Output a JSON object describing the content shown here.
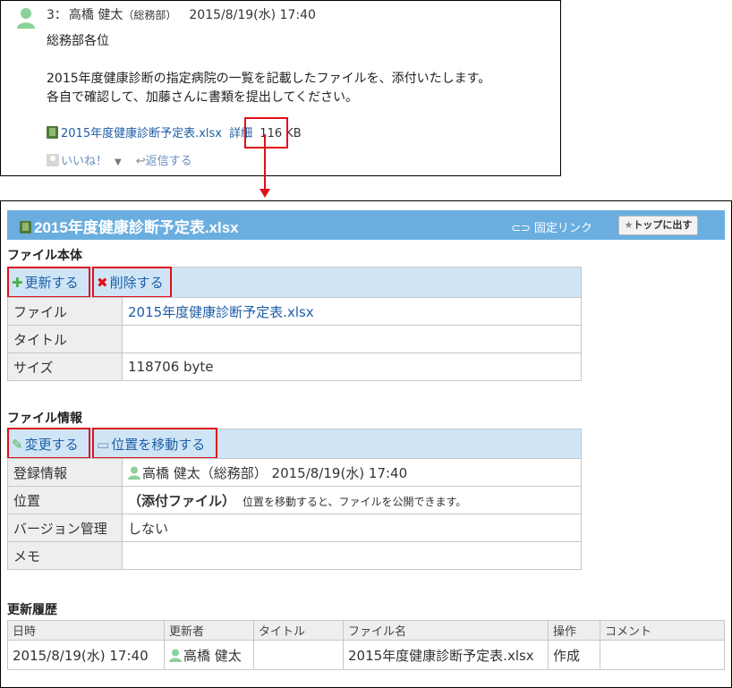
{
  "comment": {
    "number": "3：",
    "author": "高橋 健太",
    "dept": "（総務部）",
    "datetime": "2015/8/19(水) 17:40",
    "lines": [
      "総務部各位",
      "",
      "2015年度健康診断の指定病院の一覧を記載したファイルを、添付いたします。",
      "各自で確認して、加藤さんに書類を提出してください。"
    ],
    "attachment": {
      "filename": "2015年度健康診断予定表.xlsx",
      "detail_label": "詳細",
      "size": "116 KB"
    },
    "like_label": "いいね！",
    "reply_label": "返信する"
  },
  "detail": {
    "title": "2015年度健康診断予定表.xlsx",
    "fixed_link_label": "固定リンク",
    "top_button_label": "トップに出す",
    "file_body": {
      "section_title": "ファイル本体",
      "update_label": "更新する",
      "delete_label": "削除する",
      "rows": [
        {
          "key": "ファイル",
          "value": "2015年度健康診断予定表.xlsx"
        },
        {
          "key": "タイトル",
          "value": ""
        },
        {
          "key": "サイズ",
          "value": "118706 byte"
        }
      ]
    },
    "file_info": {
      "section_title": "ファイル情報",
      "change_label": "変更する",
      "move_label": "位置を移動する",
      "registration_key": "登録情報",
      "registration_value": "高橋 健太（総務部） 2015/8/19(水) 17:40",
      "location_key": "位置",
      "location_value": "（添付ファイル）",
      "location_note": "位置を移動すると、ファイルを公開できます。",
      "version_key": "バージョン管理",
      "version_value": "しない",
      "memo_key": "メモ",
      "memo_value": ""
    },
    "history": {
      "section_title": "更新履歴",
      "headers": [
        "日時",
        "更新者",
        "タイトル",
        "ファイル名",
        "操作",
        "コメント"
      ],
      "rows": [
        [
          "2015/8/19(水) 17:40",
          "高橋 健太",
          "",
          "2015年度健康診断予定表.xlsx",
          "作成",
          ""
        ]
      ]
    }
  },
  "colors": {
    "title_bar": "#6aaedf",
    "action_bar": "#cfe5f5",
    "highlight": "#e0101a",
    "link": "#1e5ea8",
    "avatar": "#8bd19a"
  },
  "icons": [
    "user-avatar-icon",
    "excel-file-icon",
    "like-icon",
    "reply-icon",
    "link-icon",
    "star-icon",
    "plus-icon",
    "delete-x-icon",
    "pencil-icon",
    "folder-icon"
  ]
}
